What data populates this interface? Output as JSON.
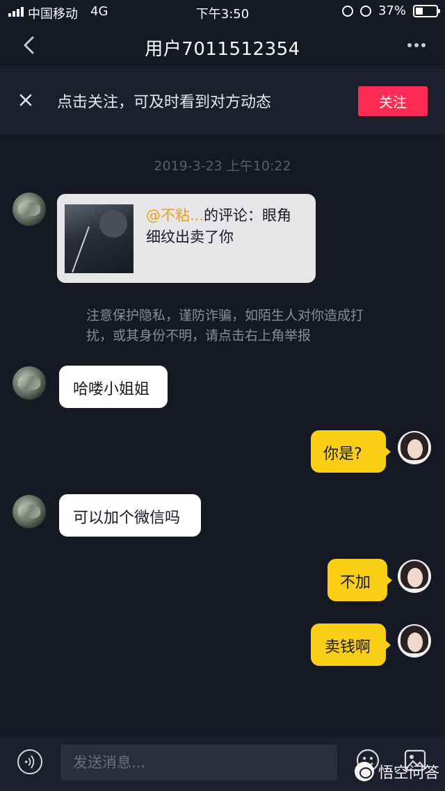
{
  "status_bar": {
    "carrier": "中国移动",
    "network": "4G",
    "time": "下午3:50",
    "battery_text": "37%",
    "battery_level": 0.37
  },
  "nav": {
    "title": "用户7011512354"
  },
  "follow_banner": {
    "text": "点击关注，可及时看到对方动态",
    "button_label": "关注",
    "button_color": "#fe2c55"
  },
  "timestamp": "2019-3-23 上午10:22",
  "share_card": {
    "mention": "@不粘...",
    "comment": "的评论：眼角细纹出卖了你"
  },
  "notice": "注意保护隐私，谨防诈骗，如陌生人对你造成打扰，或其身份不明，请点击右上角举报",
  "messages": [
    {
      "from": "other",
      "text": "哈喽小姐姐"
    },
    {
      "from": "self",
      "text": "你是?"
    },
    {
      "from": "other",
      "text": "可以加个微信吗"
    },
    {
      "from": "self",
      "text": "不加"
    },
    {
      "from": "self",
      "text": "卖钱啊"
    }
  ],
  "input": {
    "placeholder": "发送消息..."
  },
  "watermark": "悟空问答",
  "colors": {
    "background": "#161823",
    "self_bubble": "#face15",
    "other_bubble": "#ffffff",
    "mention": "#e9a216"
  }
}
